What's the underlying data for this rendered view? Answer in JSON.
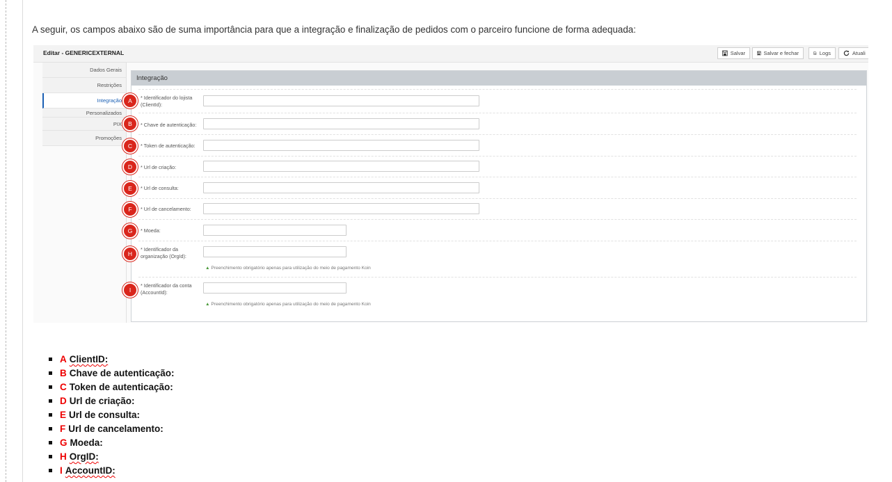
{
  "intro_text": "A seguir, os campos abaixo são de suma importância para que a integração e finalização de pedidos com o parceiro funcione de forma adequada:",
  "screenshot": {
    "title": "Editar - GENERICEXTERNAL",
    "toolbar": {
      "salvar": "Salvar",
      "salvar_fechar": "Salvar e fechar",
      "logs": "Logs",
      "atualizar": "Atuali"
    },
    "sidebar": [
      "Dados Gerais",
      "Restrições",
      "Integração",
      "Personalizados",
      "PIX",
      "Promoções"
    ],
    "panel_title": "Integração",
    "fields": [
      {
        "badge": "A",
        "label": "* Identificador do lojista (ClientId):"
      },
      {
        "badge": "B",
        "label": "* Chave de autenticação:"
      },
      {
        "badge": "C",
        "label": "* Token de autenticação:"
      },
      {
        "badge": "D",
        "label": "* Url de criação:"
      },
      {
        "badge": "E",
        "label": "* Url de consulta:"
      },
      {
        "badge": "F",
        "label": "* Url de cancelamento:"
      },
      {
        "badge": "G",
        "label": "* Moeda:"
      },
      {
        "badge": "H",
        "label": "* Identificador da organização (OrgId):",
        "hint": "Preenchimento obrigatório apenas para utilização do meio de pagamento Koin"
      },
      {
        "badge": "I",
        "label": "* Identificador da conta (AccountId):",
        "hint": "Preenchimento obrigatório apenas para utilização do meio de pagamento Koin"
      }
    ]
  },
  "list": [
    {
      "letter": "A",
      "text": "ClientID:"
    },
    {
      "letter": "B",
      "text": "Chave de autenticação:"
    },
    {
      "letter": "C",
      "text": "Token de autenticação:"
    },
    {
      "letter": "D",
      "text": "Url de criação:"
    },
    {
      "letter": "E",
      "text": "Url de consulta:"
    },
    {
      "letter": "F",
      "text": "Url de cancelamento:"
    },
    {
      "letter": "G",
      "text": "Moeda:"
    },
    {
      "letter": "H",
      "text": "OrgID:"
    },
    {
      "letter": "I",
      "text": "AccountID:"
    }
  ],
  "colors": {
    "badge": "#d9261c",
    "active_tab": "#1a5fb4",
    "list_letter": "#ee0000"
  }
}
